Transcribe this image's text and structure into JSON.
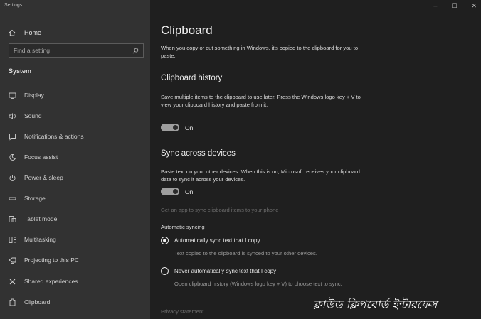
{
  "window": {
    "title": "Settings",
    "controls": [
      "–",
      "☐",
      "✕"
    ]
  },
  "sidebar": {
    "home_label": "Home",
    "search_placeholder": "Find a setting",
    "section_title": "System",
    "items": [
      {
        "label": "Display",
        "icon": "display-icon"
      },
      {
        "label": "Sound",
        "icon": "sound-icon"
      },
      {
        "label": "Notifications & actions",
        "icon": "notifications-icon"
      },
      {
        "label": "Focus assist",
        "icon": "moon-icon"
      },
      {
        "label": "Power & sleep",
        "icon": "power-icon"
      },
      {
        "label": "Storage",
        "icon": "storage-icon"
      },
      {
        "label": "Tablet mode",
        "icon": "tablet-icon"
      },
      {
        "label": "Multitasking",
        "icon": "multitasking-icon"
      },
      {
        "label": "Projecting to this PC",
        "icon": "projecting-icon"
      },
      {
        "label": "Shared experiences",
        "icon": "shared-icon"
      },
      {
        "label": "Clipboard",
        "icon": "clipboard-icon"
      }
    ]
  },
  "main": {
    "title": "Clipboard",
    "intro": "When you copy or cut something in Windows, it's copied to the clipboard for you to paste.",
    "history": {
      "heading": "Clipboard history",
      "description": "Save multiple items to the clipboard to use later. Press the Windows logo key + V to view your clipboard history and paste from it.",
      "toggle_label": "On"
    },
    "sync": {
      "heading": "Sync across devices",
      "description": "Paste text on your other devices. When this is on, Microsoft receives your clipboard data to sync it across your devices.",
      "toggle_label": "On",
      "get_app_link": "Get an app to sync clipboard items to your phone",
      "auto_sync_label": "Automatic syncing",
      "option_auto": "Automatically sync text that I copy",
      "option_auto_desc": "Text copied to the clipboard is synced to your other devices.",
      "option_never": "Never automatically sync text that I copy",
      "option_never_desc": "Open clipboard history (Windows logo key + V) to choose text to sync."
    },
    "privacy_link": "Privacy statement"
  },
  "watermark": "ক্লাউড ক্লিপবোর্ড ইন্টারফেস"
}
